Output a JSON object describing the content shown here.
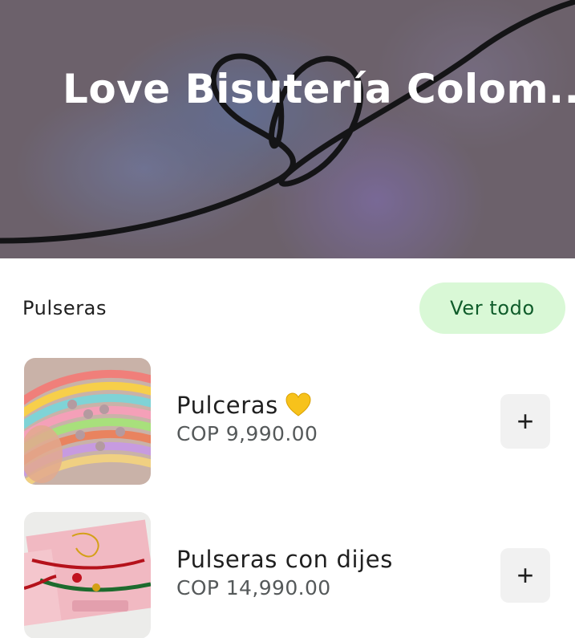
{
  "hero": {
    "title": "Love Bisutería Colom...",
    "chevron": "›",
    "background_color": "#7a7079"
  },
  "section": {
    "title": "Pulseras",
    "see_all_label": "Ver todo",
    "see_all_bg": "#d9f8d6",
    "see_all_color": "#0f5c2a"
  },
  "products": [
    {
      "name": "Pulceras",
      "emoji_icon": "yellow-heart-icon",
      "price": "COP 9,990.00",
      "image_icon": "beaded-bracelets-photo",
      "add_label": "+"
    },
    {
      "name": "Pulseras con dijes",
      "price": "COP 14,990.00",
      "image_icon": "charm-bracelets-photo",
      "add_label": "+"
    }
  ]
}
